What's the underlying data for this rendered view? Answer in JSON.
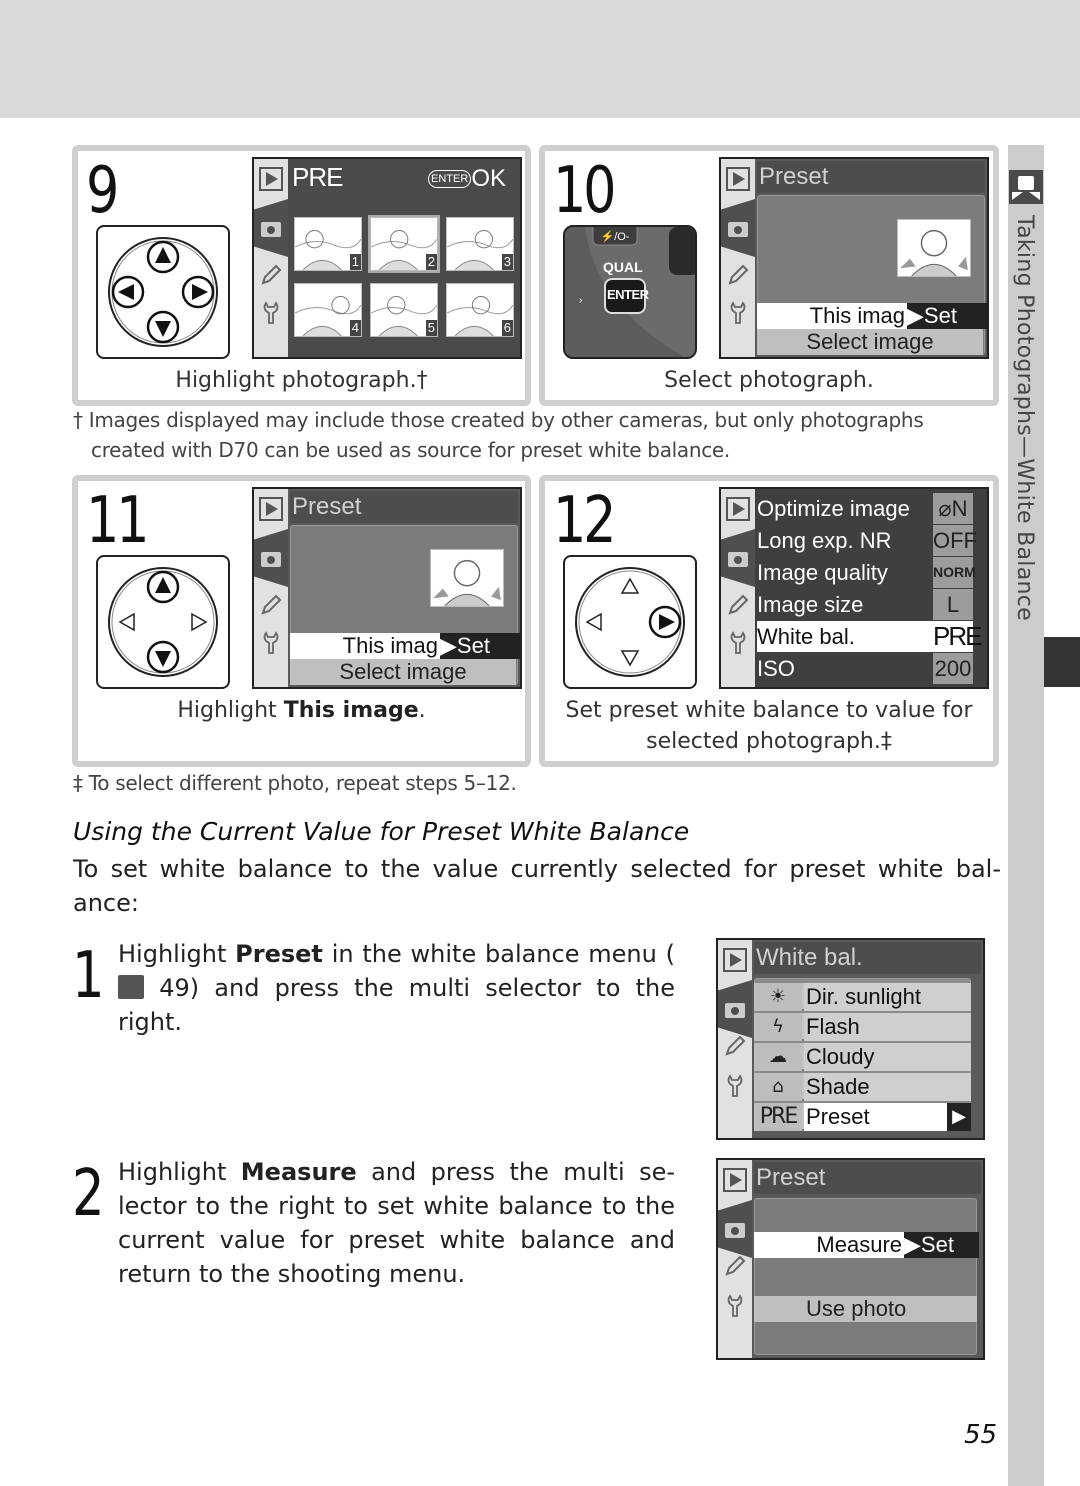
{
  "page": {
    "section_tab": "Taking Photographs—White Balance",
    "page_number": "55"
  },
  "steps": [
    {
      "number": "9",
      "caption": "Highlight photograph.†",
      "screen": {
        "title": "PRE",
        "enter_label": "ENTER",
        "ok_label": "OK",
        "thumbnails": [
          "1",
          "2",
          "3",
          "4",
          "5",
          "6"
        ],
        "selected_thumbnail": "2"
      }
    },
    {
      "number": "10",
      "caption": "Select photograph.",
      "camera_labels": {
        "qual": "QUAL",
        "enter": "ENTER"
      },
      "screen": {
        "title": "Preset",
        "highlighted_option": "This imag",
        "set_label": "▶Set",
        "other_option": "Select image"
      }
    },
    {
      "number": "11",
      "caption_prefix": "Highlight ",
      "caption_bold": "This image",
      "caption_suffix": ".",
      "screen": {
        "title": "Preset",
        "highlighted_option": "This imag",
        "set_label": "▶Set",
        "other_option": "Select image"
      }
    },
    {
      "number": "12",
      "caption": "Set preset white balance to value for selected photograph.‡",
      "screen": {
        "rows": [
          {
            "label": "Optimize image",
            "value": "⌀N"
          },
          {
            "label": "Long exp. NR",
            "value": "OFF"
          },
          {
            "label": "Image quality",
            "value": "NORM"
          },
          {
            "label": "Image size",
            "value": "L"
          },
          {
            "label": "White bal.",
            "value": "PRE",
            "selected": true
          },
          {
            "label": "ISO",
            "value": "200"
          }
        ]
      }
    }
  ],
  "footnotes": {
    "dagger": "† Images displayed may include those created by other cameras, but only photographs created with D70 can be used as source for preset white balance.",
    "double_dagger": "‡ To select different photo, repeat steps 5–12."
  },
  "section": {
    "heading": "Using the Current Value for Preset White Balance",
    "intro": "To set white balance to the value currently selected for preset white bal- ance:",
    "instructions": [
      {
        "number": "1",
        "prefix": "Highlight ",
        "bold": "Preset",
        "middle": " in the white balance menu (",
        "ref": " 49) and press the multi selector to the right."
      },
      {
        "number": "2",
        "prefix": "Highlight ",
        "bold": "Measure",
        "rest": " and press the multi se- lector to the right to set white balance to the current value for preset white balance and return to the shooting menu."
      }
    ]
  },
  "wb_menu": {
    "title": "White bal.",
    "items": [
      {
        "icon": "☀",
        "label": "Dir. sunlight"
      },
      {
        "icon": "ϟ",
        "label": "Flash"
      },
      {
        "icon": "☁",
        "label": "Cloudy"
      },
      {
        "icon": "⌂",
        "label": "Shade"
      },
      {
        "icon": "PRE",
        "label": "Preset",
        "selected": true
      }
    ],
    "arrow": "▶"
  },
  "preset_menu": {
    "title": "Preset",
    "highlighted_option": "Measure",
    "set_label": "▶Set",
    "other_option": "Use photo"
  }
}
